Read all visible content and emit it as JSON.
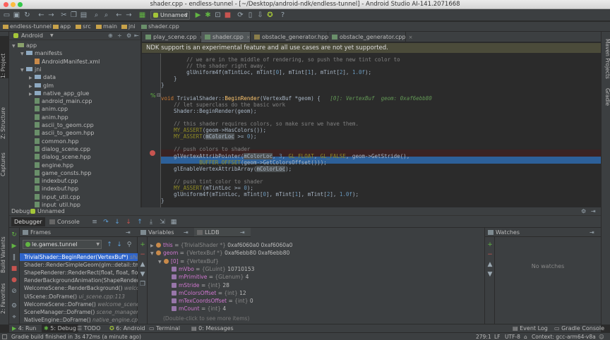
{
  "window": {
    "title": "shader.cpp - endless-tunnel - [~/Desktop/android-ndk/endless-tunnel] - Android Studio AI-141.2071668"
  },
  "toolbar": {
    "config_label": "Unnamed"
  },
  "breadcrumbs": [
    "endless-tunnel",
    "app",
    "src",
    "main",
    "jni",
    "shader.cpp"
  ],
  "left_strip": {
    "project": "1: Project",
    "structure": "Z: Structure",
    "captures": "Captures",
    "build_variants": "Build Variants",
    "favorites": "2: Favorites"
  },
  "right_strip": {
    "maven": "Maven Projects",
    "gradle": "Gradle"
  },
  "project": {
    "view_label": "Android",
    "tree": [
      {
        "label": "app",
        "depth": 0,
        "kind": "module",
        "expanded": true
      },
      {
        "label": "manifests",
        "depth": 1,
        "kind": "folder",
        "expanded": true
      },
      {
        "label": "AndroidManifest.xml",
        "depth": 2,
        "kind": "xml"
      },
      {
        "label": "jni",
        "depth": 1,
        "kind": "folder",
        "expanded": true
      },
      {
        "label": "data",
        "depth": 2,
        "kind": "folder",
        "expanded": false
      },
      {
        "label": "glm",
        "depth": 2,
        "kind": "folder",
        "expanded": false
      },
      {
        "label": "native_app_glue",
        "depth": 2,
        "kind": "folder",
        "expanded": false
      },
      {
        "label": "android_main.cpp",
        "depth": 2,
        "kind": "cpp"
      },
      {
        "label": "anim.cpp",
        "depth": 2,
        "kind": "cpp"
      },
      {
        "label": "anim.hpp",
        "depth": 2,
        "kind": "cpp"
      },
      {
        "label": "ascii_to_geom.cpp",
        "depth": 2,
        "kind": "cpp"
      },
      {
        "label": "ascii_to_geom.hpp",
        "depth": 2,
        "kind": "cpp"
      },
      {
        "label": "common.hpp",
        "depth": 2,
        "kind": "cpp"
      },
      {
        "label": "dialog_scene.cpp",
        "depth": 2,
        "kind": "cpp"
      },
      {
        "label": "dialog_scene.hpp",
        "depth": 2,
        "kind": "cpp"
      },
      {
        "label": "engine.hpp",
        "depth": 2,
        "kind": "cpp"
      },
      {
        "label": "game_consts.hpp",
        "depth": 2,
        "kind": "cpp"
      },
      {
        "label": "indexbuf.cpp",
        "depth": 2,
        "kind": "cpp"
      },
      {
        "label": "indexbuf.hpp",
        "depth": 2,
        "kind": "cpp"
      },
      {
        "label": "input_util.cpp",
        "depth": 2,
        "kind": "cpp"
      },
      {
        "label": "input_util.hpp",
        "depth": 2,
        "kind": "cpp"
      }
    ]
  },
  "editor_tabs": [
    {
      "label": "play_scene.cpp",
      "active": false
    },
    {
      "label": "shader.cpp",
      "active": true
    },
    {
      "label": "obstacle_generator.hpp",
      "active": false
    },
    {
      "label": "obstacle_generator.cpp",
      "active": false
    }
  ],
  "notice": "NDK support is an experimental feature and all use cases are not yet supported.",
  "code": {
    "lines": [
      "        // we are in the middle of rendering, so push the new tint color to",
      "        // the shader right away.",
      "        glUniform4f(mTintLoc, mTint[0], mTint[1], mTint[2], 1.0f);",
      "    }",
      "}",
      "",
      "void TrivialShader::BeginRender(VertexBuf *geom) {",
      "    // let superclass do the basic work",
      "    Shader::BeginRender(geom);",
      "",
      "    // this shader requires colors, so make sure we have them.",
      "    MY_ASSERT(geom->HasColors());",
      "    MY_ASSERT(mColorLoc >= 0);",
      "",
      "    // push colors to shader",
      "    glVertexAttribPointer(mColorLoc, 3, GL_FLOAT, GL_FALSE, geom->GetStride(),",
      "            BUFFER_OFFSET(geom->GetColorsOffset()));",
      "    glEnableVertexAttribArray(mColorLoc);",
      "",
      "    // push tint color to shader",
      "    MY_ASSERT(mTintLoc >= 0);",
      "    glUniform4f(mTintLoc, mTint[0], mTint[1], mTint[2], 1.0f);",
      "}",
      ""
    ],
    "inline_hint": "[0]: VertexBuf  geom: 0xaf6ebb80"
  },
  "debug": {
    "title": "Debug",
    "config": "Unnamed",
    "tab_debugger": "Debugger",
    "tab_console": "Console",
    "frames_label": "Frames",
    "thread": "le.games.tunnel",
    "frames": [
      {
        "fn": "TrivialShader::BeginRender(VertexBuf*)",
        "loc": "shade",
        "selected": true
      },
      {
        "fn": "Shader::RenderSimpleGeom(glm::detail::tmat4",
        "loc": "",
        "selected": false
      },
      {
        "fn": "ShapeRenderer::RenderRect(float, float, float,",
        "loc": "",
        "selected": false
      },
      {
        "fn": "RenderBackgroundAnimation(ShapeRenderer*",
        "loc": "",
        "selected": false
      },
      {
        "fn": "WelcomeScene::RenderBackground()",
        "loc": "welcome",
        "selected": false
      },
      {
        "fn": "UiScene::DoFrame()",
        "loc": "ui_scene.cpp:113",
        "selected": false
      },
      {
        "fn": "WelcomeScene::DoFrame()",
        "loc": "welcome_scene.cp",
        "selected": false
      },
      {
        "fn": "SceneManager::DoFrame()",
        "loc": "scene_manager.cp",
        "selected": false
      },
      {
        "fn": "NativeEngine::DoFrame()",
        "loc": "native_engine.cp",
        "selected": false
      }
    ],
    "variables_label": "Variables",
    "lldb_label": "LLDB",
    "variables": [
      {
        "name": "this",
        "type": "{TrivialShader *}",
        "value": "0xaf6060a0 0xaf6060a0",
        "depth": 0,
        "expand": "closed"
      },
      {
        "name": "geom",
        "type": "{VertexBuf *}",
        "value": "0xaf6ebb80 0xaf6ebb80",
        "depth": 0,
        "expand": "open"
      },
      {
        "name": "[0]",
        "type": "{VertexBuf}",
        "value": "",
        "depth": 1,
        "expand": "open"
      },
      {
        "name": "mVbo",
        "type": "{GLuint}",
        "value": "10710153",
        "depth": 2,
        "expand": "none"
      },
      {
        "name": "mPrimitive",
        "type": "{GLenum}",
        "value": "4",
        "depth": 2,
        "expand": "none"
      },
      {
        "name": "mStride",
        "type": "{int}",
        "value": "28",
        "depth": 2,
        "expand": "none"
      },
      {
        "name": "mColorsOffset",
        "type": "{int}",
        "value": "12",
        "depth": 2,
        "expand": "none"
      },
      {
        "name": "mTexCoordsOffset",
        "type": "{int}",
        "value": "0",
        "depth": 2,
        "expand": "none"
      },
      {
        "name": "mCount",
        "type": "{int}",
        "value": "4",
        "depth": 2,
        "expand": "none"
      }
    ],
    "more_hint": "(Double-click to see more items)",
    "watches_label": "Watches",
    "no_watches": "No watches"
  },
  "bottom_tabs": [
    {
      "label": "4: Run",
      "active": false
    },
    {
      "label": "5: Debug",
      "active": true
    },
    {
      "label": "TODO",
      "active": false
    },
    {
      "label": "6: Android",
      "active": false
    },
    {
      "label": "Terminal",
      "active": false
    },
    {
      "label": "0: Messages",
      "active": false
    }
  ],
  "bottom_right_tabs": {
    "event_log": "Event Log",
    "gradle_console": "Gradle Console"
  },
  "status": {
    "message": "Gradle build finished in 3s 472ms (a minute ago)",
    "position": "279:1",
    "line_sep": "LF",
    "encoding": "UTF-8",
    "context": "Context: gcc-arm64-v8a"
  }
}
